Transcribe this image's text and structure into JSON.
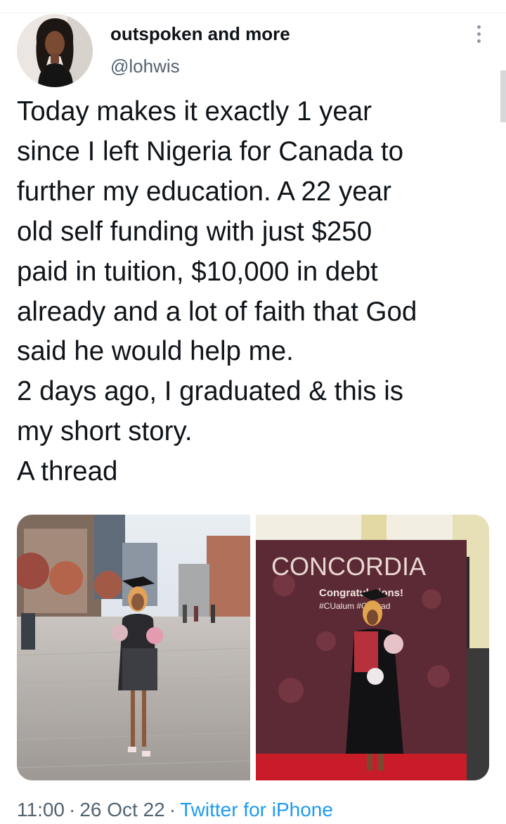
{
  "tweet": {
    "display_name": "outspoken and more",
    "handle": "@lohwis",
    "text_lines": [
      "Today makes it exactly 1 year",
      "since I left Nigeria for Canada to",
      "further my education. A 22 year",
      "old self funding with just $250",
      "paid in tuition, $10,000 in debt",
      "already and a lot of faith that God",
      "said he would help me.",
      "2 days ago, I graduated & this is",
      "my short story.",
      "A thread"
    ],
    "media": [
      {
        "description_icon": "photo-street-graduate",
        "alt": ""
      },
      {
        "description_icon": "photo-concordia-backdrop",
        "backdrop_title": "CONCORDIA",
        "backdrop_subtitle": "Congratulations!",
        "backdrop_hashtags": "#CUalum #CUgrad"
      }
    ],
    "time": "11:00",
    "separator": "·",
    "date": "26 Oct 22",
    "source": "Twitter for iPhone"
  },
  "icons": {
    "more": "more-vertical-icon"
  },
  "colors": {
    "text": "#0f1419",
    "secondary": "#536471",
    "link": "#1d9bf0",
    "backdrop": "#5c2a34"
  }
}
